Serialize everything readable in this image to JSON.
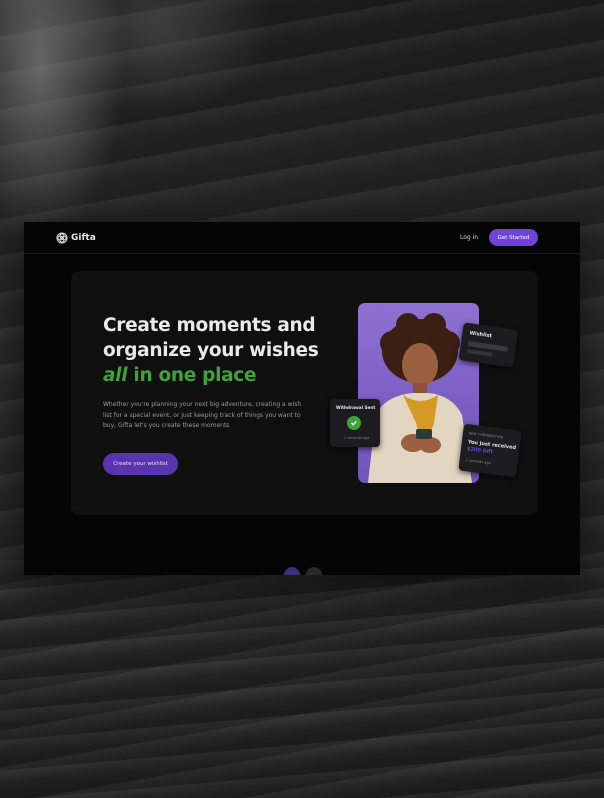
{
  "nav": {
    "brand": "Gifta",
    "login_label": "Log in",
    "cta_label": "Get Started"
  },
  "hero": {
    "title_line1": "Create moments and",
    "title_line2": "organize your wishes",
    "title_highlight_italic": "all",
    "title_highlight_rest": " in one place",
    "description": "Whether you're planning your next big adventure, creating a wish list for a special event, or just keeping track of things you want to buy, Gifta let's you create these moments",
    "cta_label": "Create your wishlist"
  },
  "cards": {
    "wishlist_title": "Wishlist",
    "withdrawal_title": "Withdrawal Sent",
    "withdrawal_time": "2 seconds ago",
    "gift_label": "NEW CONTRIBUTION",
    "gift_title": "You just received",
    "gift_amount": "$200 Gift",
    "gift_time": "2 seconds ago"
  },
  "colors": {
    "accent_purple": "#6f43d8",
    "highlight_green": "#3ea33a",
    "background": "#050505"
  }
}
